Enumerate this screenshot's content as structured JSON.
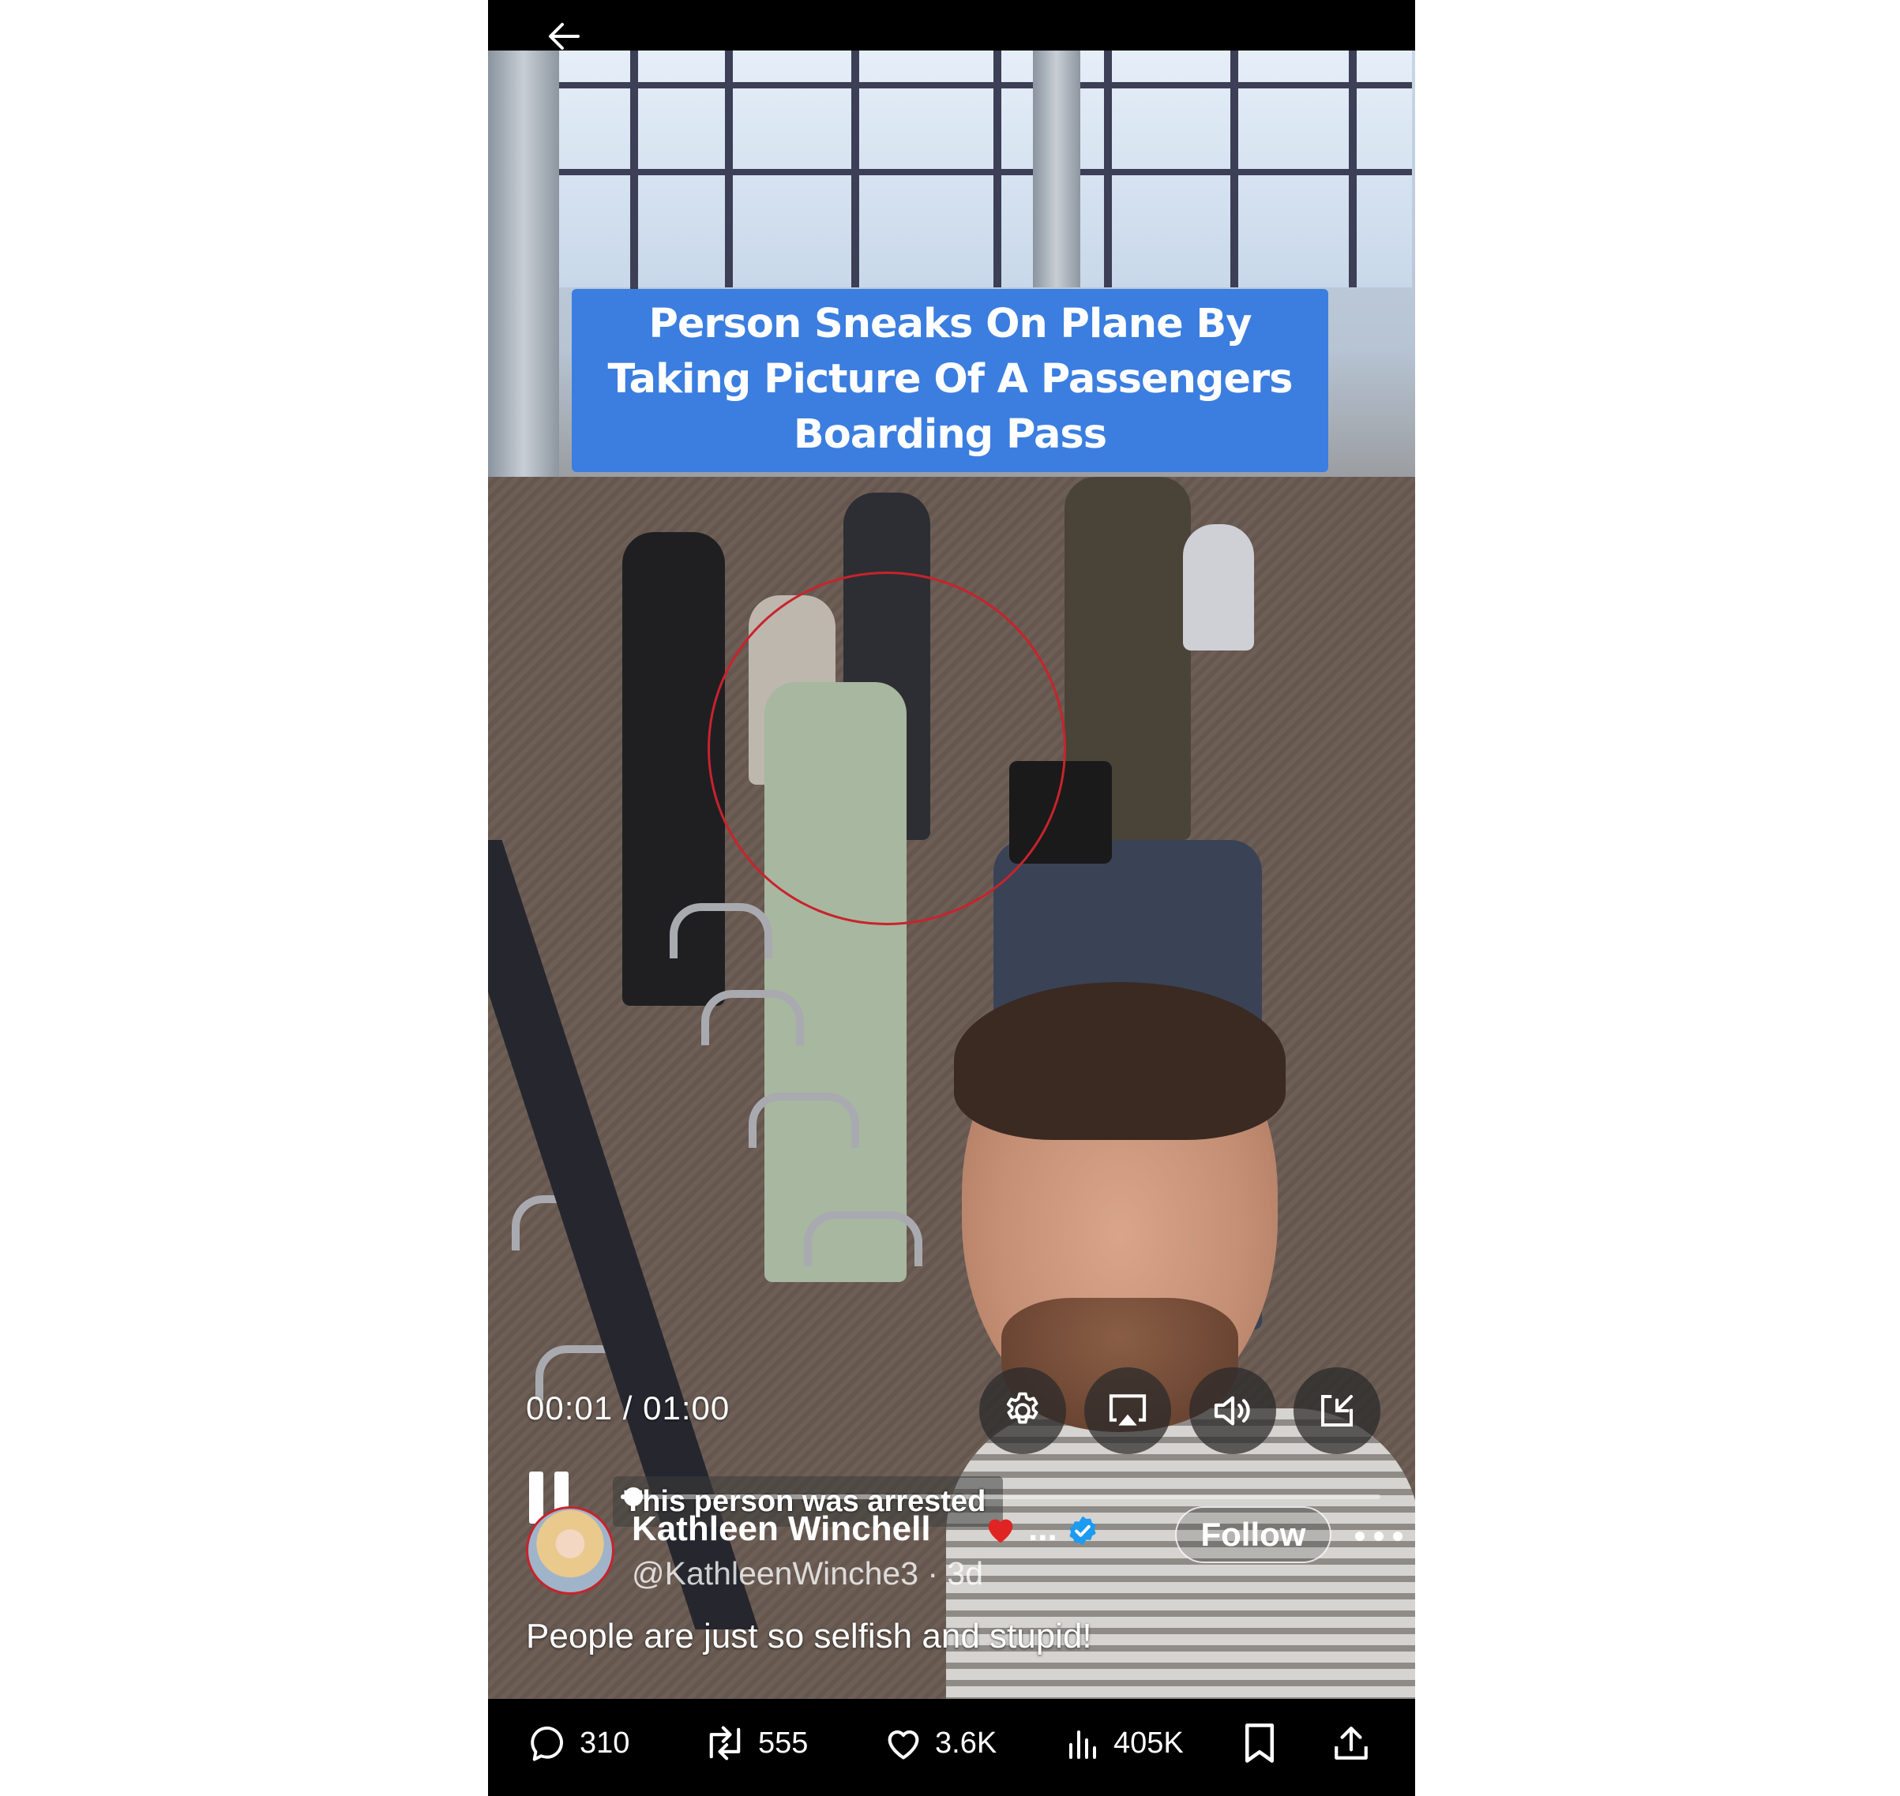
{
  "topbar": {
    "back_icon": "arrow-left-icon"
  },
  "video": {
    "caption_banner": "Person Sneaks On Plane By Taking Picture Of A Passengers Boarding Pass",
    "caption_banner_color": "#3b7ee0",
    "highlight_color": "#c8232c",
    "time_readout": "00:01 / 01:00",
    "subtitle": "This person was arrested",
    "progress_fraction": 0.017,
    "controls": [
      {
        "name": "settings",
        "icon": "gear-icon"
      },
      {
        "name": "airplay",
        "icon": "airplay-icon"
      },
      {
        "name": "volume",
        "icon": "speaker-icon"
      },
      {
        "name": "exit-fullscreen",
        "icon": "minimize-icon"
      }
    ]
  },
  "author": {
    "name": "Kathleen Winchell",
    "name_suffix": "...",
    "handle": "@KathleenWinche3 · 3d",
    "verified": true,
    "verified_color": "#1d9bf0",
    "follow_label": "Follow"
  },
  "post": {
    "text": "People are just so selfish and stupid!"
  },
  "actions": {
    "replies": "310",
    "reposts": "555",
    "likes": "3.6K",
    "views": "405K"
  }
}
